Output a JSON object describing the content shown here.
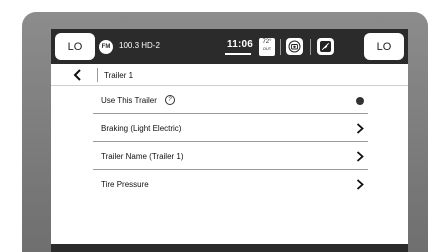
{
  "status_bar": {
    "left_temp": "LO",
    "right_temp": "LO",
    "source_badge": "FM",
    "station": "100.3 HD-2",
    "clock": "11:06",
    "outside_temp_value": "72°",
    "outside_temp_label": "OUT",
    "icons": [
      "camera-icon",
      "climate-off-icon"
    ]
  },
  "nav": {
    "back_icon": "chevron-left-icon",
    "title": "Trailer 1"
  },
  "settings": {
    "items": [
      {
        "label": "Use This Trailer",
        "control": "radio-selected"
      },
      {
        "label": "Braking  (Light Electric)",
        "control": "chevron-right"
      },
      {
        "label": "Trailer Name  (Trailer 1)",
        "control": "chevron-right"
      },
      {
        "label": "Tire Pressure",
        "control": "chevron-right"
      }
    ]
  }
}
